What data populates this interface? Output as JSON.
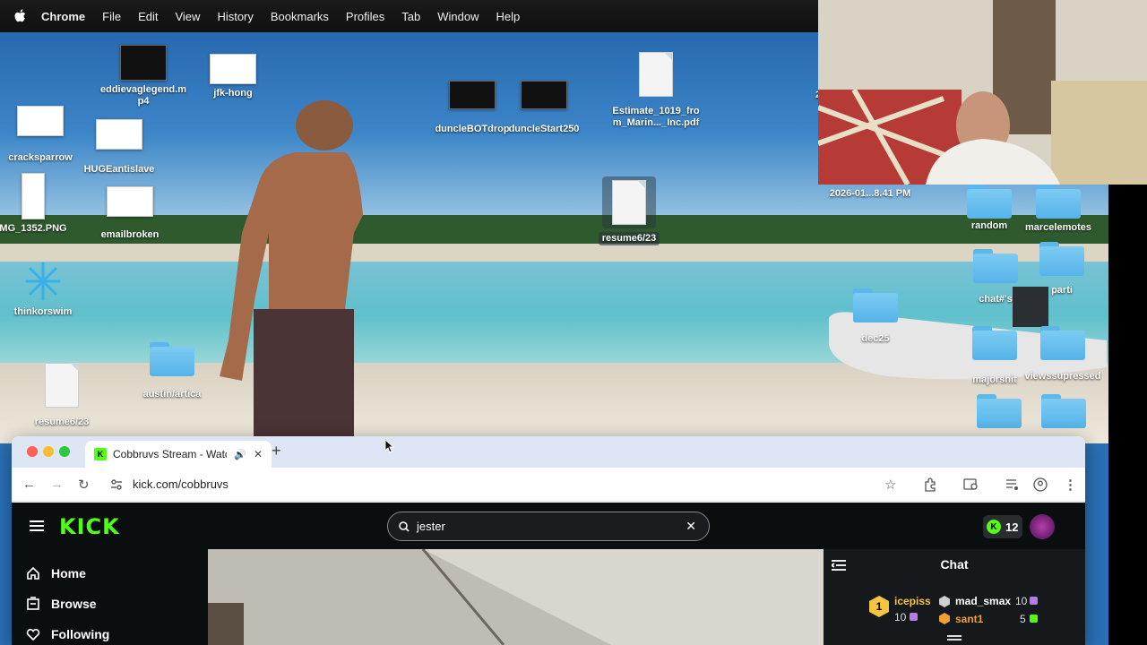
{
  "menubar": {
    "app": "Chrome",
    "items": [
      "File",
      "Edit",
      "View",
      "History",
      "Bookmarks",
      "Profiles",
      "Tab",
      "Window",
      "Help"
    ]
  },
  "desktop": {
    "icons": {
      "eddievaglegend": "eddievaglegend.m\np4",
      "jfk": "jfk-hong",
      "cracksparrow": "cracksparrow",
      "hugeantislave": "HUGEantislave",
      "img1352": "MG_1352.PNG",
      "emailbroken": "emailbroken",
      "thinkorswim": "thinkorswim",
      "austin": "austin/artica",
      "resume_left": "resume6/23",
      "duncle_bot": "duncleBOTdrop",
      "duncle_start": "duncleStart250",
      "estimate": "Estimate_1019_fro\nm_Marin..._Inc.pdf",
      "resume_center": "resume6/23",
      "screenshot": "2026-01...8.41 PM",
      "random": "random",
      "marcelemotes": "marcelemotes",
      "chat": "chat#'s",
      "parti": "parti",
      "dec25": "dec25",
      "majorshit": "majorshit",
      "viewssupressed": "viewssupressed",
      "partial_left_edge": "2"
    }
  },
  "browser": {
    "tab_title": "Cobbruvs Stream - Watch",
    "url": "kick.com/cobbruvs"
  },
  "kick": {
    "search_value": "jester",
    "points": "12",
    "nav": {
      "home": "Home",
      "browse": "Browse",
      "following": "Following"
    },
    "chat": {
      "title": "Chat",
      "leaderboard": [
        {
          "rank": "1",
          "name": "icepiss",
          "count": "10",
          "color": "#f5c542"
        },
        {
          "rank": "2",
          "name": "mad_smax",
          "count": "10",
          "color": "#ffffff"
        },
        {
          "rank": "3",
          "name": "sant1",
          "count": "5",
          "color": "#f0a030"
        }
      ]
    }
  },
  "colors": {
    "kick_green": "#53fc18",
    "kick_bg": "#0b0e0f",
    "chrome_tabstrip": "#dee6f5"
  }
}
